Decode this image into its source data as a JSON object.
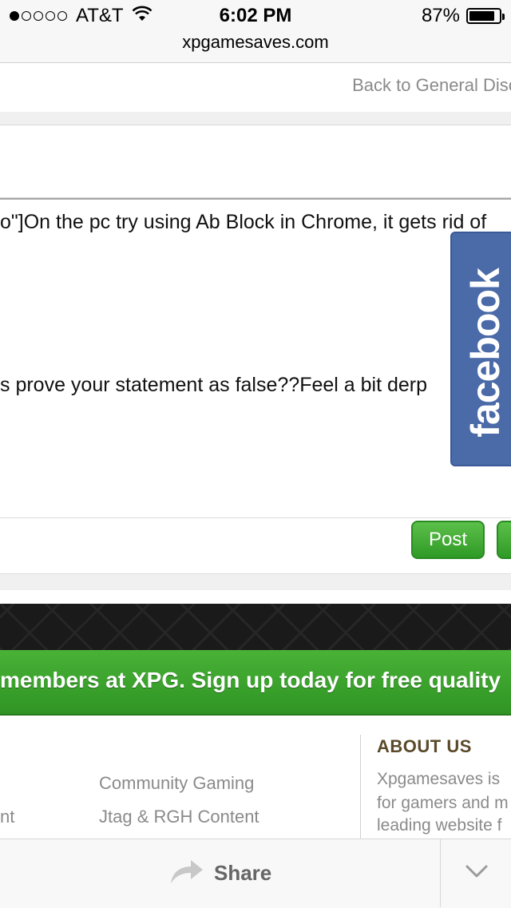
{
  "status_bar": {
    "carrier": "AT&T",
    "time": "6:02 PM",
    "battery": "87%",
    "signal_bars_filled": 1,
    "signal_bars_total": 5,
    "battery_level": 0.87
  },
  "browser": {
    "url": "xpgamesaves.com"
  },
  "thread": {
    "back_link": "Back to General Discu"
  },
  "editor": {
    "line1": "o\"]On the pc try using Ab Block in Chrome, it gets rid of",
    "line2": "s prove your statement as false??Feel a bit derp"
  },
  "facebook_tab": {
    "label": "facebook"
  },
  "actions": {
    "post_label": "Post"
  },
  "banner": {
    "text": "members at XPG. Sign up today for free quality"
  },
  "footer": {
    "links": [
      "Community Gaming",
      "Jtag & RGH Content"
    ],
    "left_fragment": "nt",
    "about": {
      "title": "ABOUT US",
      "lines": [
        "Xpgamesaves is",
        "for gamers and m",
        "leading website f"
      ]
    }
  },
  "bottom_bar": {
    "share_label": "Share",
    "share_icon": "share-arrow-icon",
    "menu_icon": "chevron-down-icon"
  },
  "colors": {
    "post_button": "#2f9a26",
    "facebook_blue": "#4a6aa8",
    "banner_green": "#3fa52f",
    "about_title": "#5a4a2a"
  }
}
